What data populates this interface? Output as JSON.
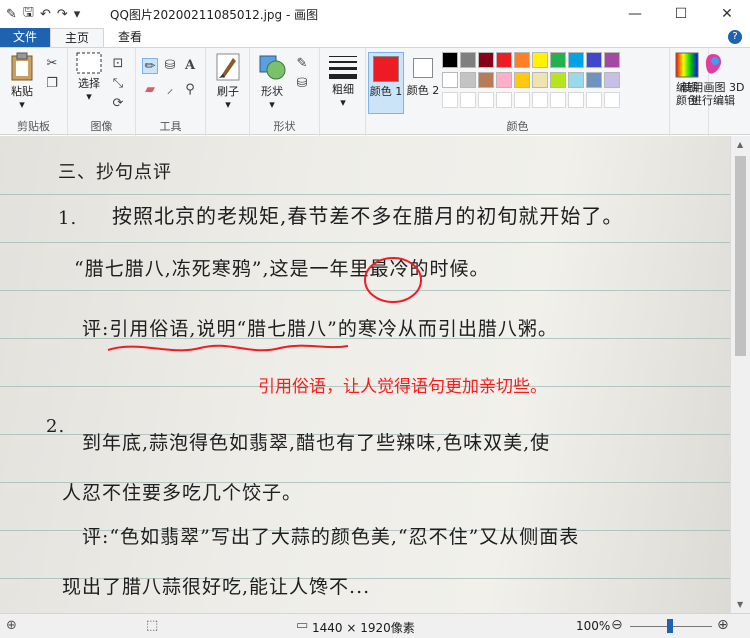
{
  "window": {
    "title": "QQ图片20200211085012.jpg - 画图"
  },
  "tabs": {
    "file": "文件",
    "home": "主页",
    "view": "查看"
  },
  "ribbon": {
    "clipboard": {
      "paste": "粘贴",
      "group": "剪贴板"
    },
    "image": {
      "select": "选择",
      "group": "图像"
    },
    "tools": {
      "group": "工具"
    },
    "brush": "刷子",
    "shapes": {
      "label": "形状",
      "group": "形状"
    },
    "size": "粗细",
    "color1": "颜色 1",
    "color2": "颜色 2",
    "colors_group": "颜色",
    "edit_colors": "编辑颜色",
    "paint3d": "使用画图 3D 进行编辑"
  },
  "palette": {
    "row1": [
      "#000000",
      "#7f7f7f",
      "#880015",
      "#ed1c24",
      "#ff7f27",
      "#fff200",
      "#22b14c",
      "#00a2e8",
      "#3f48cc",
      "#a349a4"
    ],
    "row2": [
      "#ffffff",
      "#c3c3c3",
      "#b97a57",
      "#ffaec9",
      "#ffc90e",
      "#efe4b0",
      "#b5e61d",
      "#99d9ea",
      "#7092be",
      "#c8bfe7"
    ],
    "color1_value": "#ed1c24",
    "color2_value": "#ffffff"
  },
  "document": {
    "heading": "三、抄句点评",
    "item1_num": "1.",
    "line1": "按照北京的老规矩,春节差不多在腊月的初旬就开始了。",
    "line2": "“腊七腊八,冻死寒鸦”,这是一年里最冷的时候。",
    "comment1": "评:引用俗语,说明“腊七腊八”的寒冷从而引出腊八粥。",
    "red_annotation": "引用俗语，让人觉得语句更加亲切些。",
    "item2_num": "2.",
    "line3": "到年底,蒜泡得色如翡翠,醋也有了些辣味,色味双美,使",
    "line4": "人忍不住要多吃几个饺子。",
    "comment2": "评:“色如翡翠”写出了大蒜的颜色美,“忍不住”又从侧面表",
    "line5": "现出了腊八蒜很好吃,能让人馋不..."
  },
  "status": {
    "dimensions": "1440 × 1920像素",
    "zoom": "100%"
  }
}
